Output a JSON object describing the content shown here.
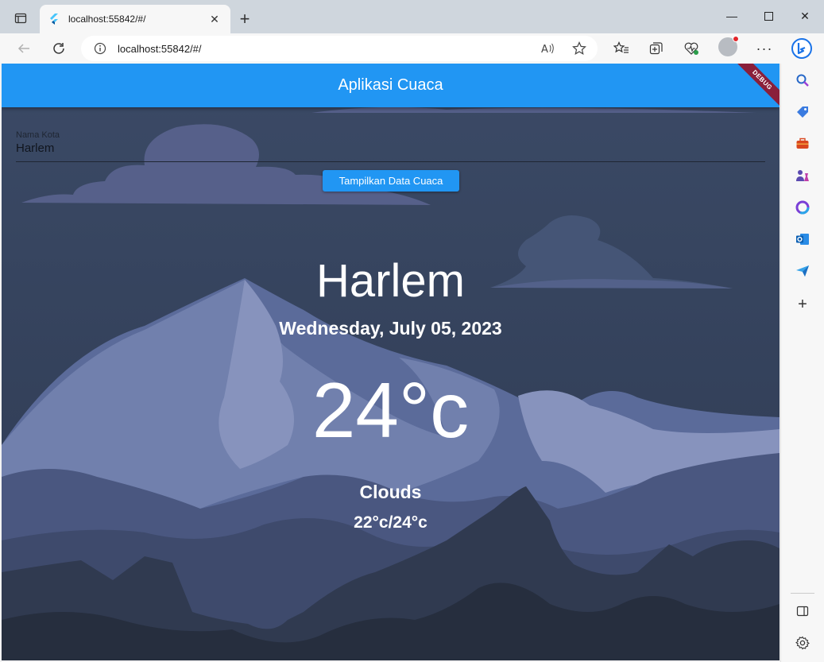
{
  "browser": {
    "tab_title": "localhost:55842/#/",
    "address": "localhost:55842/#/"
  },
  "app": {
    "title": "Aplikasi Cuaca",
    "debug_banner": "DEBUG",
    "city_field": {
      "label": "Nama Kota",
      "value": "Harlem"
    },
    "submit_label": "Tampilkan Data Cuaca",
    "weather": {
      "city": "Harlem",
      "date": "Wednesday, July 05, 2023",
      "temperature": "24°c",
      "condition": "Clouds",
      "min_max": "22°c/24°c"
    }
  },
  "colors": {
    "accent": "#2196f3",
    "sky_top": "#3b4a66",
    "mountain_light": "#6a79a6",
    "mountain_dark": "#262e3e"
  }
}
